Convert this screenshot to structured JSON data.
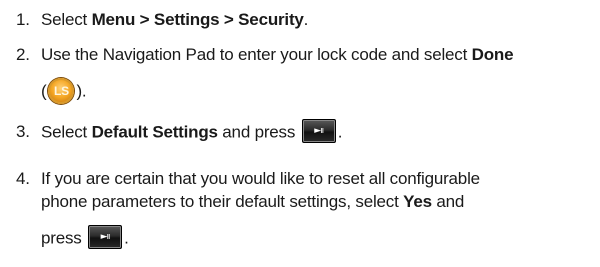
{
  "steps": [
    {
      "number": "1.",
      "parts": {
        "t1": "Select ",
        "b1": "Menu > Settings > Security",
        "t2": "."
      }
    },
    {
      "number": "2.",
      "parts": {
        "t1": "Use the Navigation Pad to enter your lock code and select ",
        "b1": "Done",
        "t2": "(",
        "icon": "LS",
        "t3": ")."
      }
    },
    {
      "number": "3.",
      "parts": {
        "t1": "Select ",
        "b1": "Default Settings",
        "t2": " and press ",
        "icon": "►ıı",
        "t3": "."
      }
    },
    {
      "number": "4.",
      "parts": {
        "t1": "If you are certain that you would like to reset all configurable",
        "t2": "phone parameters to their default settings, select ",
        "b1": "Yes",
        "t3": " and",
        "t4": "press ",
        "icon": "►ıı",
        "t5": "."
      }
    }
  ],
  "icons": {
    "lock_key": "ls-lock-key-icon",
    "play_pause_key": "play-pause-key-icon"
  },
  "colors": {
    "text": "#1a1a1a",
    "lock_key_fill": "#f5a623",
    "play_key_fill": "#2b2b2b"
  }
}
